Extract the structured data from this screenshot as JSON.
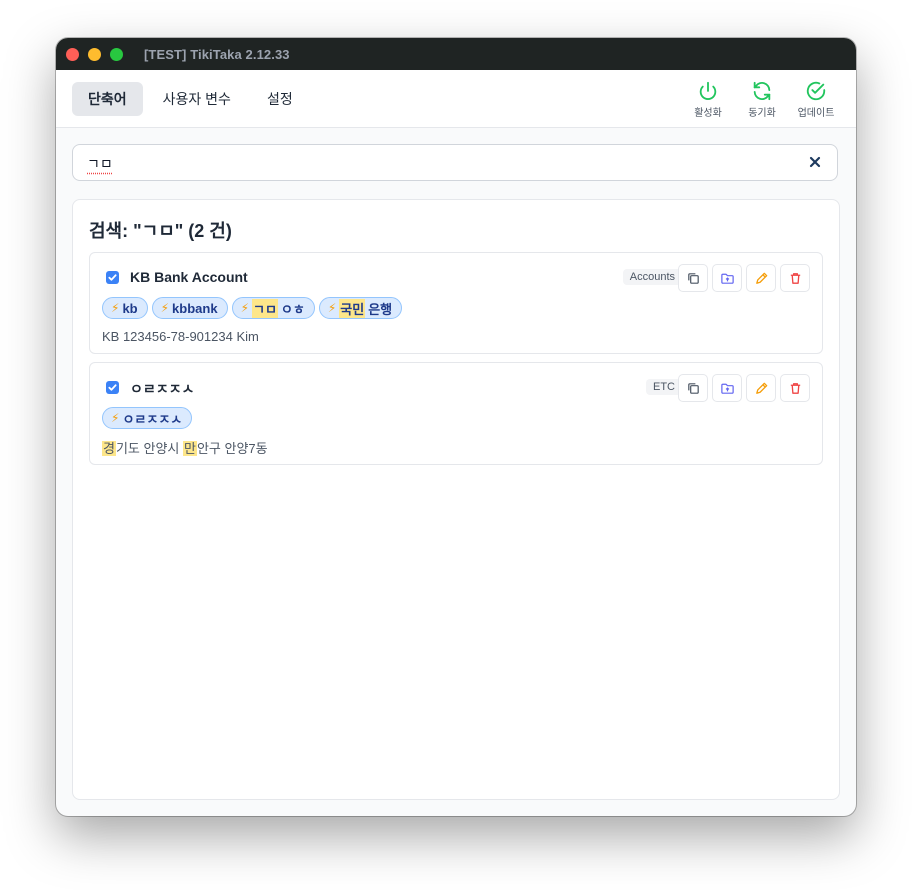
{
  "window": {
    "title": "[TEST] TikiTaka 2.12.33"
  },
  "tabs": [
    {
      "label": "단축어"
    },
    {
      "label": "사용자 변수"
    },
    {
      "label": "설정"
    }
  ],
  "actions": {
    "activate": "활성화",
    "sync": "동기화",
    "update": "업데이트"
  },
  "search": {
    "value": "ㄱㅁ"
  },
  "results": {
    "title": "검색: \"ㄱㅁ\" (2 건)"
  },
  "cards": [
    {
      "name": "KB Bank Account",
      "category": "Accounts",
      "tags": [
        "kb",
        "kbbank"
      ],
      "tag3": {
        "highlight": "ㄱㅁ",
        "rest": "ㅇㅎ"
      },
      "tag4": {
        "highlight": "국민",
        "rest": "은행"
      },
      "content": "KB 123456-78-901234 Kim"
    },
    {
      "name": "ㅇㄹㅈㅈㅅ",
      "category": "ETC",
      "tags": [
        "ㅇㄹㅈㅈㅅ"
      ],
      "content_parts": [
        "경",
        "기도 안양시 ",
        "만",
        "안구 안양7동"
      ]
    }
  ],
  "colors": {
    "accent": "#3b82f6",
    "activate_icon": "#22c55e",
    "tag_bg": "#dbeafe",
    "highlight": "#fde68a",
    "edit_icon": "#f59e0b",
    "delete_icon": "#ef4444",
    "move_icon": "#6366f1"
  },
  "icons": {
    "activate": "power-icon",
    "sync": "refresh-icon",
    "update": "check-circle-icon",
    "copy": "copy-icon",
    "move": "folder-upload-icon",
    "edit": "pencil-icon",
    "delete": "trash-icon",
    "clear": "close-icon",
    "tag": "lightning-icon"
  }
}
